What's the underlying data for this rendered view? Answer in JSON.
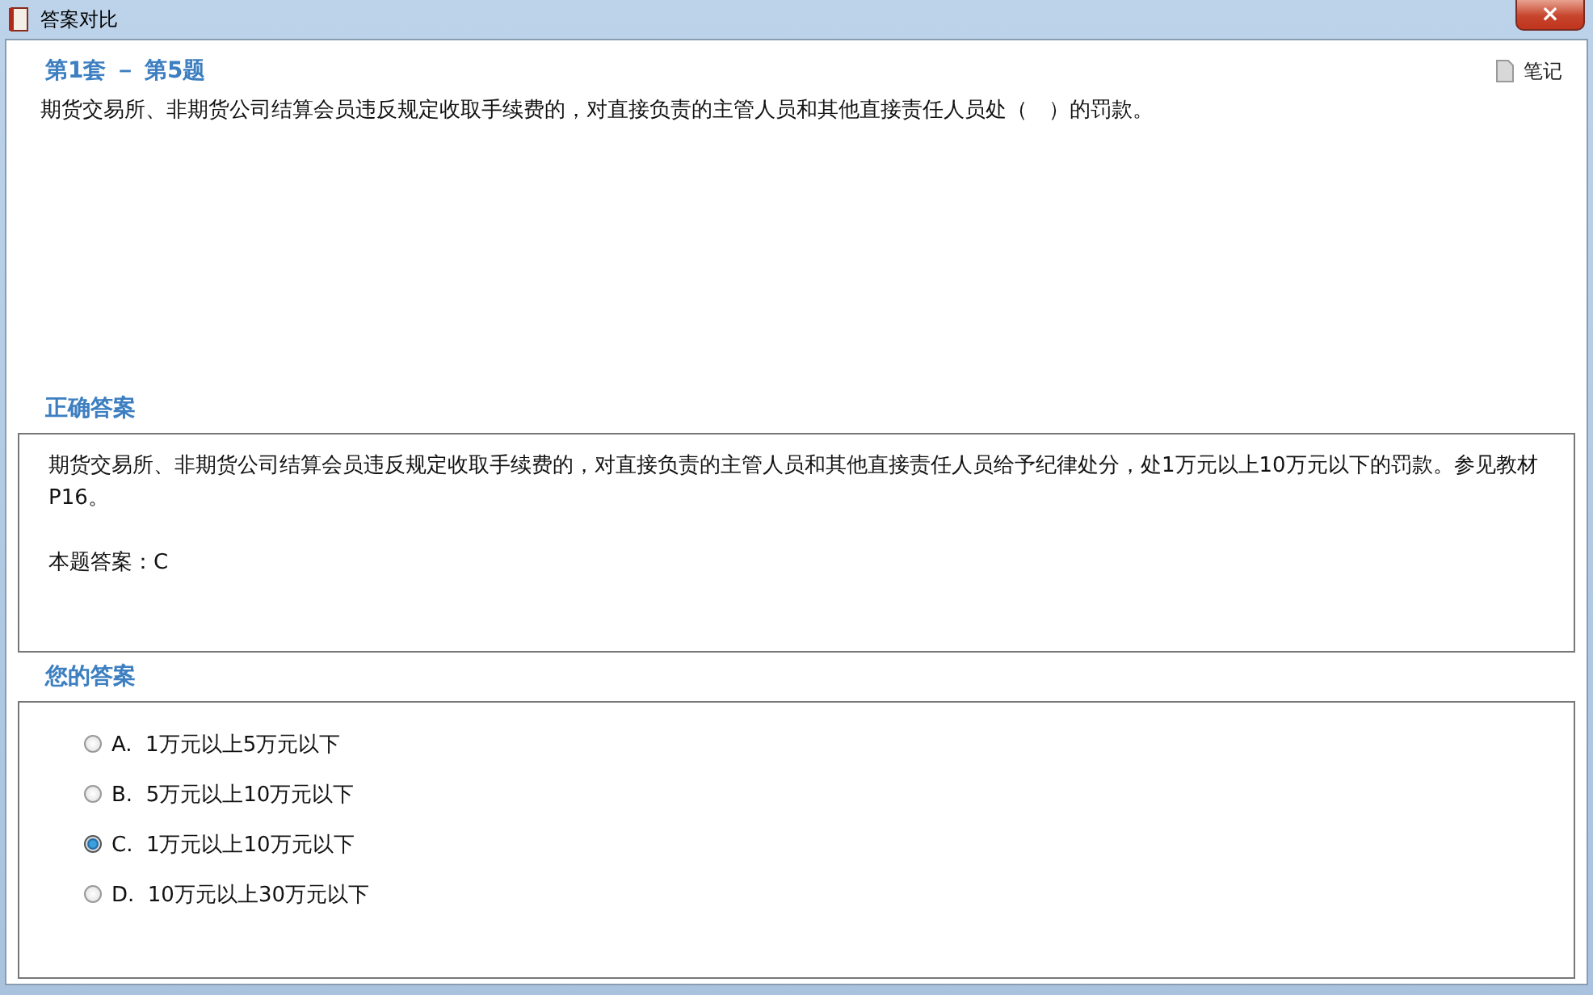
{
  "window": {
    "title": "答案对比",
    "close": "×"
  },
  "question": {
    "heading": "第1套 － 第5题",
    "note_button": "笔记",
    "text": "期货交易所、非期货公司结算会员违反规定收取手续费的，对直接负责的主管人员和其他直接责任人员处（　）的罚款。"
  },
  "correct_answer": {
    "heading": "正确答案",
    "explanation": "期货交易所、非期货公司结算会员违反规定收取手续费的，对直接负责的主管人员和其他直接责任人员给予纪律处分，处1万元以上10万元以下的罚款。参见教材P16。",
    "answer": "本题答案：C"
  },
  "your_answer": {
    "heading": "您的答案",
    "options": [
      {
        "label": "A.  1万元以上5万元以下",
        "selected": false
      },
      {
        "label": "B.  5万元以上10万元以下",
        "selected": false
      },
      {
        "label": "C.  1万元以上10万元以下",
        "selected": true
      },
      {
        "label": "D.  10万元以上30万元以下",
        "selected": false
      }
    ]
  }
}
